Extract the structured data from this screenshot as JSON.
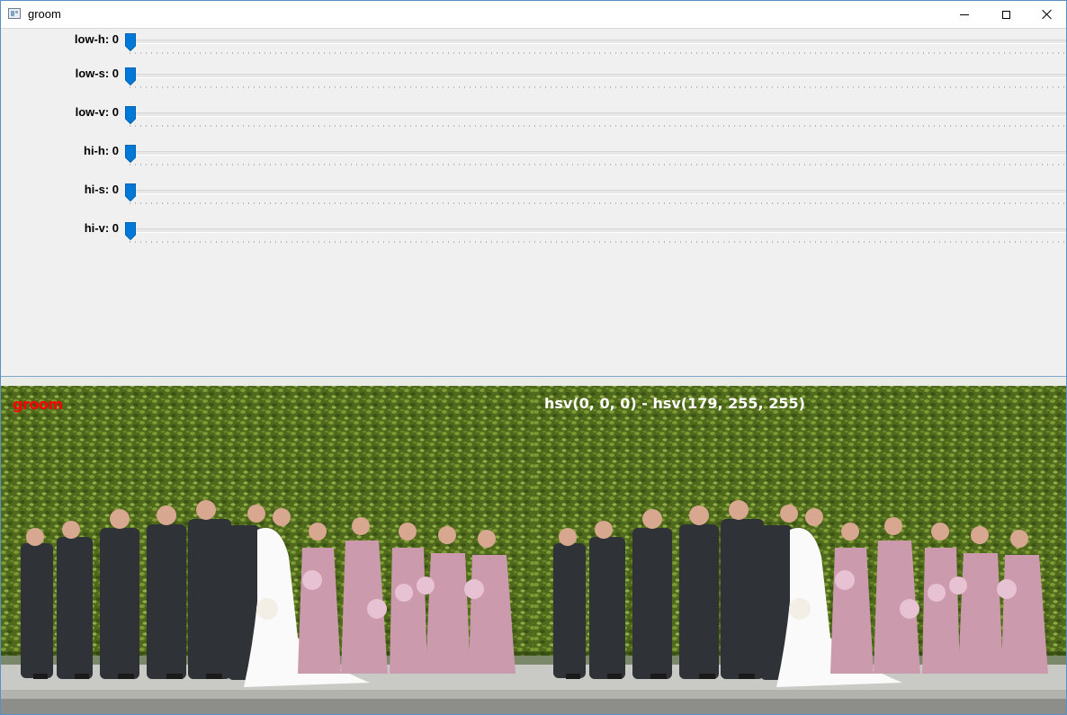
{
  "window": {
    "title": "groom",
    "controls": {
      "minimize": "minimize-icon",
      "maximize": "maximize-icon",
      "close": "close-icon"
    }
  },
  "trackbars": [
    {
      "label": "low-h: 0",
      "value": 0
    },
    {
      "label": "low-s: 0",
      "value": 0
    },
    {
      "label": "low-v: 0",
      "value": 0
    },
    {
      "label": "hi-h: 0",
      "value": 0
    },
    {
      "label": "hi-s: 0",
      "value": 0
    },
    {
      "label": "hi-v: 0",
      "value": 0
    }
  ],
  "images": {
    "left_overlay": "groom",
    "right_overlay": "hsv(0, 0, 0) - hsv(179, 255, 255)",
    "left_overlay_color": "#ff0000",
    "right_overlay_color": "#ffffff"
  },
  "colors": {
    "accent": "#0078d7",
    "panel_bg": "#f0f0f0"
  }
}
